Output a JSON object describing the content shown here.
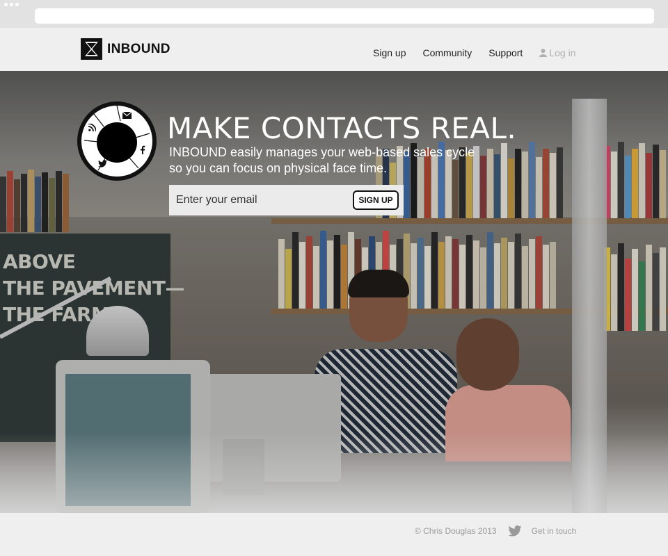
{
  "brand": {
    "name": "INBOUND"
  },
  "nav": {
    "items": [
      {
        "label": "Sign up"
      },
      {
        "label": "Community"
      },
      {
        "label": "Support"
      }
    ],
    "login_label": "Log in"
  },
  "hero": {
    "headline": "MAKE CONTACTS REAL.",
    "tagline_line1": "INBOUND easily manages your web-based sales cycle",
    "tagline_line2": "so you can focus on physical face time.",
    "poster_lines": [
      "ABOVE",
      "THE PAVEMENT—",
      "THE FARM!"
    ],
    "social_icons": [
      "email-icon",
      "rss-icon",
      "facebook-icon",
      "twitter-icon"
    ]
  },
  "signup_form": {
    "email_placeholder": "Enter your email",
    "button_label": "SIGN UP"
  },
  "footer": {
    "copyright": "© Chris Douglas 2013",
    "contact_label": "Get in touch"
  },
  "colors": {
    "header_bg": "#efefef",
    "footer_text": "#9a9a9a",
    "login_text": "#b0b0b0",
    "brand_dark": "#111111"
  }
}
